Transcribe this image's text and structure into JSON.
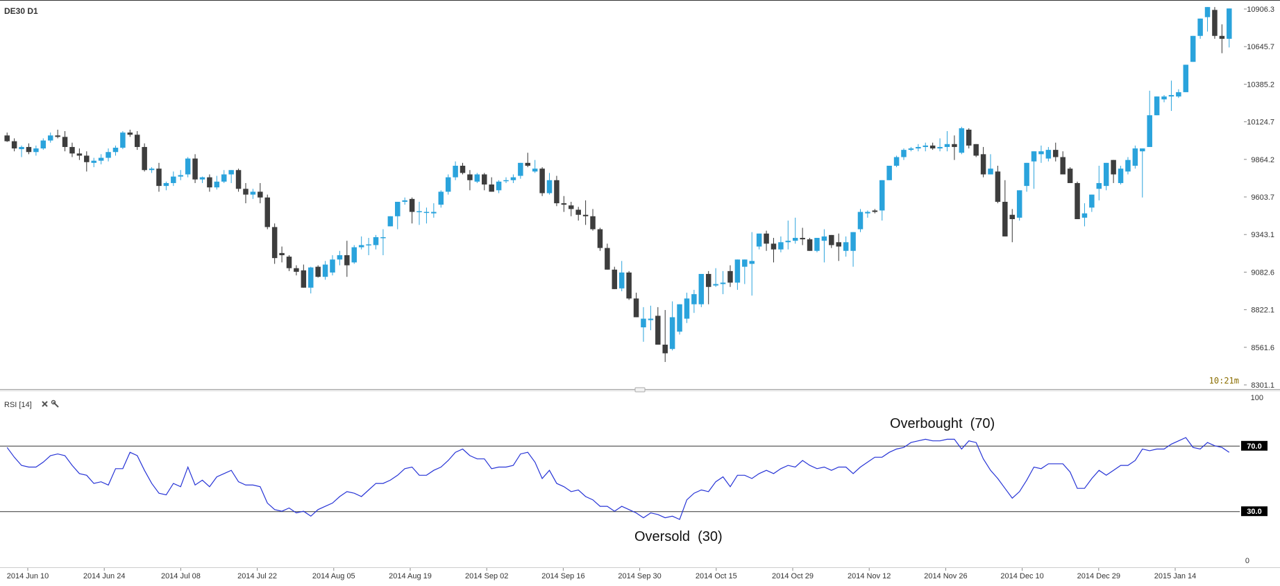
{
  "chart_data": {
    "type": "candlestick",
    "symbol_label": "DE30 D1",
    "price_ticks": [
      "10906.3",
      "10645.7",
      "10385.2",
      "10124.7",
      "9864.2",
      "9603.7",
      "9343.1",
      "9082.6",
      "8822.1",
      "8561.6",
      "8301.1"
    ],
    "price_axis_range": [
      8301.1,
      10906.3
    ],
    "timer_label": "10:21m",
    "x_ticks": [
      "2014 Jun 10",
      "2014 Jun 24",
      "2014 Jul 08",
      "2014 Jul 22",
      "2014 Aug 05",
      "2014 Aug 19",
      "2014 Sep 02",
      "2014 Sep 16",
      "2014 Sep 30",
      "2014 Oct 15",
      "2014 Oct 29",
      "2014 Nov 12",
      "2014 Nov 26",
      "2014 Dec 10",
      "2014 Dec 29",
      "2015 Jan 14"
    ],
    "colors": {
      "up": "#2aa3dc",
      "down": "#3d3d3d",
      "rsi_line": "#2633d6"
    },
    "candles": [
      [
        10030,
        10050,
        9985,
        9990
      ],
      [
        9990,
        10010,
        9920,
        9940
      ],
      [
        9935,
        9960,
        9880,
        9950
      ],
      [
        9950,
        9975,
        9900,
        9915
      ],
      [
        9915,
        9960,
        9890,
        9940
      ],
      [
        9940,
        10010,
        9930,
        9995
      ],
      [
        9995,
        10050,
        9980,
        10030
      ],
      [
        10030,
        10070,
        10010,
        10020
      ],
      [
        10020,
        10060,
        9920,
        9950
      ],
      [
        9950,
        9980,
        9880,
        9905
      ],
      [
        9905,
        9940,
        9860,
        9890
      ],
      [
        9890,
        9920,
        9780,
        9845
      ],
      [
        9840,
        9875,
        9810,
        9855
      ],
      [
        9855,
        9900,
        9830,
        9875
      ],
      [
        9875,
        9940,
        9850,
        9915
      ],
      [
        9915,
        9960,
        9890,
        9945
      ],
      [
        9945,
        10060,
        9935,
        10050
      ],
      [
        10050,
        10070,
        10020,
        10035
      ],
      [
        10035,
        10060,
        9930,
        9950
      ],
      [
        9950,
        9975,
        9780,
        9790
      ],
      [
        9790,
        9810,
        9770,
        9800
      ],
      [
        9800,
        9840,
        9640,
        9680
      ],
      [
        9680,
        9710,
        9650,
        9700
      ],
      [
        9700,
        9780,
        9680,
        9745
      ],
      [
        9745,
        9790,
        9720,
        9755
      ],
      [
        9760,
        9880,
        9740,
        9870
      ],
      [
        9870,
        9900,
        9700,
        9725
      ],
      [
        9725,
        9745,
        9700,
        9740
      ],
      [
        9740,
        9760,
        9640,
        9670
      ],
      [
        9670,
        9750,
        9655,
        9710
      ],
      [
        9710,
        9790,
        9700,
        9760
      ],
      [
        9760,
        9790,
        9700,
        9790
      ],
      [
        9790,
        9800,
        9640,
        9660
      ],
      [
        9660,
        9700,
        9560,
        9620
      ],
      [
        9620,
        9660,
        9590,
        9640
      ],
      [
        9640,
        9700,
        9560,
        9600
      ],
      [
        9600,
        9620,
        9380,
        9395
      ],
      [
        9395,
        9420,
        9140,
        9180
      ],
      [
        9215,
        9260,
        9150,
        9200
      ],
      [
        9190,
        9200,
        9090,
        9110
      ],
      [
        9110,
        9130,
        9060,
        9085
      ],
      [
        9095,
        9135,
        8985,
        8975
      ],
      [
        8975,
        9120,
        8935,
        9115
      ],
      [
        9120,
        9130,
        9045,
        9050
      ],
      [
        9050,
        9160,
        9030,
        9135
      ],
      [
        9080,
        9200,
        9060,
        9170
      ],
      [
        9170,
        9230,
        9130,
        9200
      ],
      [
        9200,
        9300,
        9050,
        9130
      ],
      [
        9150,
        9270,
        9140,
        9255
      ],
      [
        9255,
        9330,
        9240,
        9270
      ],
      [
        9270,
        9320,
        9200,
        9275
      ],
      [
        9270,
        9340,
        9240,
        9325
      ],
      [
        9325,
        9380,
        9200,
        9325
      ],
      [
        9400,
        9470,
        9400,
        9470
      ],
      [
        9470,
        9560,
        9380,
        9570
      ],
      [
        9570,
        9600,
        9550,
        9580
      ],
      [
        9590,
        9600,
        9420,
        9500
      ],
      [
        9500,
        9570,
        9410,
        9505
      ],
      [
        9495,
        9530,
        9420,
        9500
      ],
      [
        9490,
        9560,
        9460,
        9500
      ],
      [
        9550,
        9650,
        9530,
        9640
      ],
      [
        9640,
        9760,
        9620,
        9740
      ],
      [
        9740,
        9850,
        9720,
        9820
      ],
      [
        9820,
        9840,
        9760,
        9770
      ],
      [
        9760,
        9790,
        9650,
        9720
      ],
      [
        9710,
        9770,
        9700,
        9760
      ],
      [
        9760,
        9770,
        9650,
        9690
      ],
      [
        9690,
        9740,
        9640,
        9640
      ],
      [
        9650,
        9720,
        9630,
        9710
      ],
      [
        9715,
        9740,
        9700,
        9720
      ],
      [
        9720,
        9760,
        9700,
        9740
      ],
      [
        9750,
        9840,
        9730,
        9840
      ],
      [
        9840,
        9910,
        9810,
        9820
      ],
      [
        9780,
        9860,
        9770,
        9800
      ],
      [
        9800,
        9810,
        9610,
        9630
      ],
      [
        9630,
        9770,
        9620,
        9720
      ],
      [
        9720,
        9750,
        9540,
        9560
      ],
      [
        9560,
        9610,
        9500,
        9550
      ],
      [
        9545,
        9570,
        9470,
        9520
      ],
      [
        9515,
        9535,
        9440,
        9480
      ],
      [
        9480,
        9580,
        9410,
        9470
      ],
      [
        9470,
        9520,
        9370,
        9380
      ],
      [
        9380,
        9390,
        9230,
        9250
      ],
      [
        9250,
        9280,
        9150,
        9100
      ],
      [
        9100,
        9120,
        8970,
        8965
      ],
      [
        8970,
        9160,
        8950,
        9080
      ],
      [
        9080,
        9090,
        8890,
        8900
      ],
      [
        8900,
        8940,
        8820,
        8770
      ],
      [
        8700,
        8840,
        8600,
        8760
      ],
      [
        8750,
        8850,
        8680,
        8760
      ],
      [
        8780,
        8840,
        8580,
        8580
      ],
      [
        8580,
        8820,
        8460,
        8520
      ],
      [
        8550,
        8880,
        8540,
        8770
      ],
      [
        8670,
        8840,
        8650,
        8860
      ],
      [
        8760,
        8940,
        8730,
        8900
      ],
      [
        8860,
        8960,
        8800,
        8930
      ],
      [
        8860,
        9000,
        8840,
        9070
      ],
      [
        9070,
        9090,
        8860,
        8980
      ],
      [
        8990,
        9110,
        8980,
        9000
      ],
      [
        9000,
        9090,
        8930,
        9010
      ],
      [
        9090,
        9130,
        8980,
        9010
      ],
      [
        9010,
        9170,
        8960,
        9170
      ],
      [
        9120,
        9120,
        9000,
        9170
      ],
      [
        9140,
        9360,
        8920,
        9160
      ],
      [
        9260,
        9350,
        9240,
        9350
      ],
      [
        9350,
        9370,
        9230,
        9280
      ],
      [
        9280,
        9320,
        9150,
        9240
      ],
      [
        9240,
        9330,
        9220,
        9290
      ],
      [
        9290,
        9440,
        9240,
        9300
      ],
      [
        9300,
        9460,
        9280,
        9320
      ],
      [
        9320,
        9390,
        9270,
        9310
      ],
      [
        9310,
        9320,
        9250,
        9230
      ],
      [
        9230,
        9310,
        9220,
        9320
      ],
      [
        9300,
        9380,
        9150,
        9330
      ],
      [
        9340,
        9320,
        9250,
        9270
      ],
      [
        9290,
        9350,
        9160,
        9260
      ],
      [
        9230,
        9330,
        9190,
        9290
      ],
      [
        9230,
        9340,
        9120,
        9360
      ],
      [
        9380,
        9520,
        9360,
        9500
      ],
      [
        9490,
        9510,
        9460,
        9500
      ],
      [
        9510,
        9520,
        9490,
        9500
      ],
      [
        9510,
        9640,
        9440,
        9720
      ],
      [
        9720,
        9800,
        9720,
        9820
      ],
      [
        9820,
        9890,
        9810,
        9880
      ],
      [
        9880,
        9940,
        9860,
        9930
      ],
      [
        9930,
        9950,
        9920,
        9940
      ],
      [
        9940,
        9970,
        9920,
        9950
      ],
      [
        9950,
        9980,
        9920,
        9960
      ],
      [
        9960,
        9980,
        9930,
        9940
      ],
      [
        9940,
        10010,
        9920,
        9950
      ],
      [
        9950,
        10060,
        9920,
        9970
      ],
      [
        9970,
        10030,
        9860,
        9950
      ],
      [
        9910,
        10090,
        9900,
        10080
      ],
      [
        10070,
        10080,
        9940,
        9960
      ],
      [
        9970,
        9950,
        9880,
        9890
      ],
      [
        9900,
        9950,
        9740,
        9760
      ],
      [
        9760,
        9900,
        9760,
        9800
      ],
      [
        9780,
        9820,
        9560,
        9570
      ],
      [
        9570,
        9720,
        9540,
        9330
      ],
      [
        9480,
        9520,
        9290,
        9450
      ],
      [
        9460,
        9650,
        9440,
        9650
      ],
      [
        9680,
        9740,
        9640,
        9840
      ],
      [
        9850,
        9920,
        9660,
        9920
      ],
      [
        9900,
        9960,
        9840,
        9920
      ],
      [
        9870,
        9950,
        9850,
        9930
      ],
      [
        9930,
        9980,
        9850,
        9880
      ],
      [
        9880,
        9920,
        9780,
        9760
      ],
      [
        9800,
        9810,
        9730,
        9700
      ],
      [
        9700,
        9710,
        9470,
        9450
      ],
      [
        9460,
        9560,
        9400,
        9490
      ],
      [
        9530,
        9520,
        9500,
        9620
      ],
      [
        9660,
        9820,
        9580,
        9700
      ],
      [
        9680,
        9820,
        9650,
        9840
      ],
      [
        9860,
        9860,
        9700,
        9760
      ],
      [
        9700,
        9820,
        9690,
        9800
      ],
      [
        9780,
        9880,
        9760,
        9860
      ],
      [
        9820,
        9960,
        9800,
        9940
      ],
      [
        9920,
        9920,
        9600,
        9940
      ],
      [
        9950,
        10340,
        9960,
        10170
      ],
      [
        10170,
        10300,
        10180,
        10300
      ],
      [
        10280,
        10310,
        10260,
        10300
      ],
      [
        10300,
        10410,
        10200,
        10310
      ],
      [
        10300,
        10350,
        10290,
        10330
      ],
      [
        10330,
        10510,
        10400,
        10520
      ],
      [
        10540,
        10580,
        10560,
        10720
      ],
      [
        10720,
        10780,
        10700,
        10840
      ],
      [
        10850,
        10900,
        10750,
        10920
      ],
      [
        10900,
        10920,
        10700,
        10720
      ],
      [
        10720,
        10800,
        10600,
        10700
      ],
      [
        10700,
        10900,
        10640,
        10910
      ]
    ],
    "rsi": {
      "label": "RSI [14]",
      "ticks": [
        "100",
        "0"
      ],
      "levels": [
        70,
        30
      ],
      "level_labels": [
        "70.0",
        "30.0"
      ],
      "overbought_label": "Overbought  (70)",
      "oversold_label": "Oversold  (30)",
      "values": [
        69,
        63,
        58,
        57,
        57,
        60,
        64,
        65,
        64,
        58,
        53,
        52,
        47,
        48,
        46,
        56,
        56,
        66,
        64,
        55,
        47,
        41,
        40,
        47,
        45,
        57,
        46,
        49,
        45,
        51,
        53,
        55,
        48,
        46,
        46,
        45,
        35,
        31,
        30,
        32,
        29,
        30,
        27,
        31,
        33,
        35,
        39,
        42,
        41,
        39,
        43,
        47,
        47,
        49,
        52,
        56,
        57,
        52,
        52,
        55,
        57,
        61,
        66,
        68,
        64,
        62,
        62,
        56,
        57,
        57,
        58,
        65,
        66,
        60,
        50,
        55,
        47,
        45,
        42,
        43,
        39,
        37,
        33,
        33,
        30,
        33,
        31,
        29,
        26,
        29,
        28,
        26,
        27,
        25,
        37,
        41,
        43,
        42,
        48,
        51,
        45,
        52,
        52,
        50,
        53,
        55,
        53,
        56,
        58,
        57,
        61,
        58,
        56,
        57,
        55,
        57,
        57,
        53,
        57,
        60,
        63,
        63,
        66,
        68,
        69,
        72,
        73,
        74,
        73,
        73,
        74,
        74,
        68,
        73,
        72,
        62,
        55,
        50,
        44,
        38,
        42,
        49,
        57,
        56,
        59,
        59,
        59,
        54,
        44,
        44,
        50,
        55,
        52,
        55,
        58,
        58,
        61,
        68,
        67,
        68,
        68,
        71,
        73,
        75,
        69,
        68,
        72,
        70,
        69,
        66
      ]
    }
  }
}
